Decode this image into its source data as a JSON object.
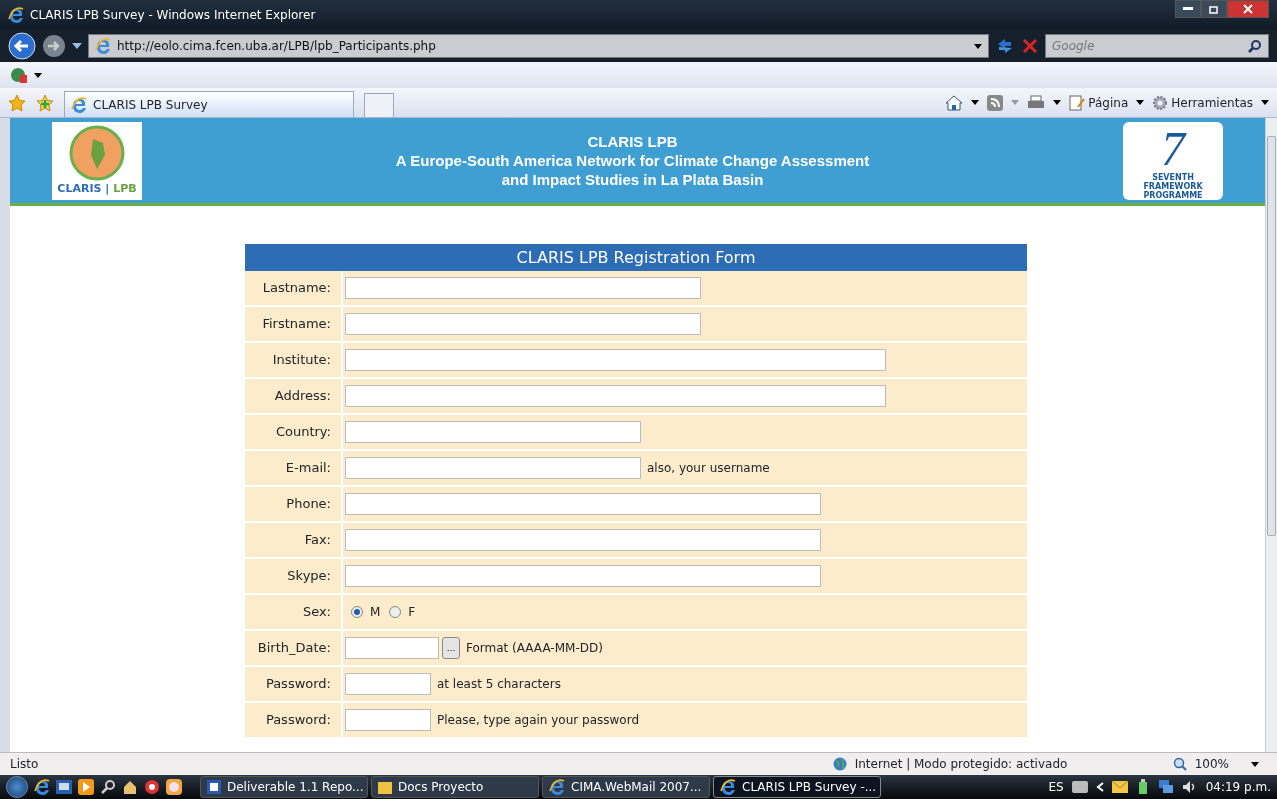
{
  "window": {
    "title": "CLARIS LPB Survey - Windows Internet Explorer"
  },
  "address_bar": {
    "url": "http://eolo.cima.fcen.uba.ar/LPB/lpb_Participants.php"
  },
  "search": {
    "placeholder": "Google"
  },
  "tabs": [
    {
      "label": "CLARIS LPB Survey",
      "selected": true
    }
  ],
  "command_bar": {
    "items": [
      "Página",
      "Herramientas"
    ]
  },
  "banner": {
    "left_logo": {
      "name": "CLARIS",
      "separator": "|",
      "suffix": "LPB"
    },
    "lines": [
      "CLARIS LPB",
      "A Europe-South America Network for Climate Change Assessment",
      "and Impact Studies in La Plata Basin"
    ],
    "right_logo": {
      "numeral": "7",
      "caption": "SEVENTH FRAMEWORK PROGRAMME"
    }
  },
  "form": {
    "title": "CLARIS LPB Registration Form",
    "rows": [
      {
        "kind": "text",
        "label": "Lastname:"
      },
      {
        "kind": "text",
        "label": "Firstname:"
      },
      {
        "kind": "text",
        "label": "Institute:"
      },
      {
        "kind": "text",
        "label": "Address:"
      },
      {
        "kind": "text",
        "label": "Country:"
      },
      {
        "kind": "text",
        "label": "E-mail:",
        "note": "also, your username"
      },
      {
        "kind": "text",
        "label": "Phone:"
      },
      {
        "kind": "text",
        "label": "Fax:"
      },
      {
        "kind": "text",
        "label": "Skype:"
      },
      {
        "kind": "radio",
        "label": "Sex:",
        "options": [
          {
            "label": "M",
            "selected": true
          },
          {
            "label": "F",
            "selected": false
          }
        ]
      },
      {
        "kind": "date",
        "label": "Birth_Date:",
        "button": "...",
        "note": "Format (AAAA-MM-DD)"
      },
      {
        "kind": "password",
        "label": "Password:",
        "note": "at least 5 characters"
      },
      {
        "kind": "password",
        "label": "Password:",
        "note": "Please, type again your password"
      }
    ]
  },
  "status_bar": {
    "text": "Listo",
    "zone": "Internet | Modo protegido: activado",
    "zoom": "100%"
  },
  "taskbar": {
    "buttons": [
      {
        "label": "Deliverable 1.1 Repo...",
        "selected": false
      },
      {
        "label": "Docs Proyecto",
        "selected": false
      },
      {
        "label": "CIMA.WebMail 2007...",
        "selected": false
      },
      {
        "label": "CLARIS LPB Survey -...",
        "selected": true
      }
    ],
    "language": "ES",
    "clock": "04:19 p.m."
  }
}
